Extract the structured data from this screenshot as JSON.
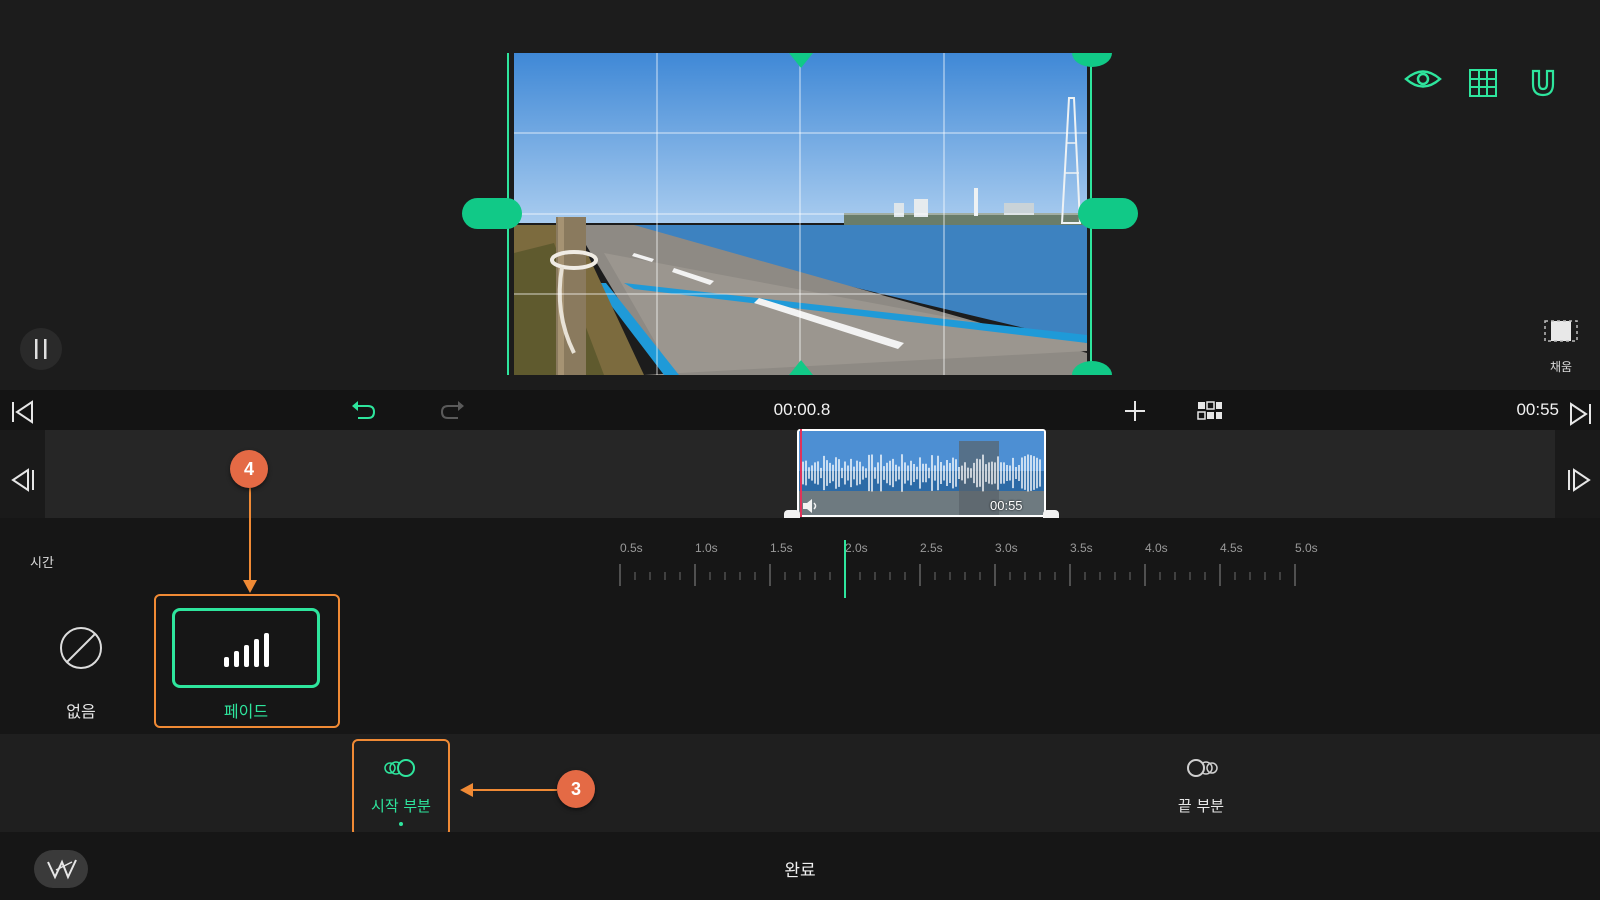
{
  "preview": {
    "fill_label": "채움"
  },
  "toolbar": {
    "current_time": "00:00.8",
    "total_time": "00:55"
  },
  "clip": {
    "duration": "00:55"
  },
  "panel": {
    "section_label": "시간",
    "options": [
      {
        "label": "없음",
        "icon": "none-icon"
      },
      {
        "label": "페이드",
        "icon": "fade-bars-icon",
        "selected": true
      }
    ],
    "ruler_ticks": [
      "0.5s",
      "1.0s",
      "1.5s",
      "2.0s",
      "2.5s",
      "3.0s",
      "3.5s",
      "4.0s",
      "4.5s",
      "5.0s"
    ],
    "selected_duration_s": 2.0
  },
  "tabs": [
    {
      "label": "시작 부분",
      "icon": "fade-in-icon",
      "active": true
    },
    {
      "label": "끝 부분",
      "icon": "fade-out-icon",
      "active": false
    }
  ],
  "annotations": {
    "badge_fade": "4",
    "badge_start": "3"
  },
  "bottom": {
    "done_label": "완료"
  },
  "colors": {
    "accent": "#2ee59d",
    "annotation": "#f08a35",
    "badge": "#e46a45"
  }
}
